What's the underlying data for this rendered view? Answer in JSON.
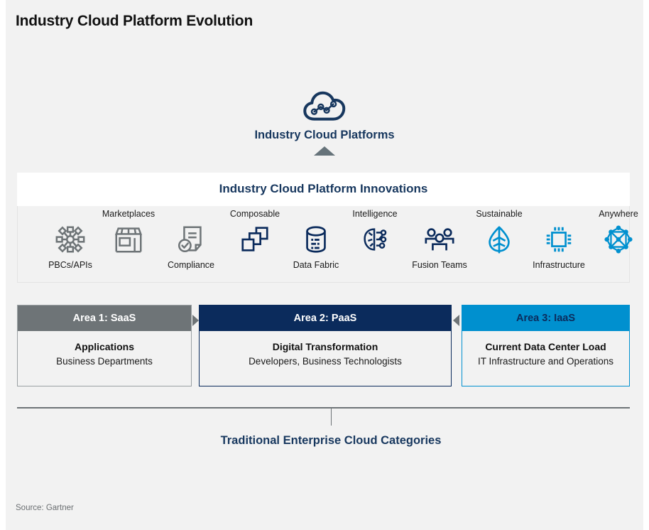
{
  "page": {
    "title": "Industry Cloud Platform Evolution",
    "source": "Source: Gartner",
    "background": "#f2f2f2"
  },
  "hero": {
    "icon": "cloud-network-icon",
    "label": "Industry Cloud Platforms",
    "caret": "up-triangle-icon",
    "color": "#17375e"
  },
  "innovations": {
    "title": "Industry Cloud Platform Innovations",
    "title_color": "#17375e",
    "items": [
      {
        "label": "PBCs/APIs",
        "icon": "hub-nodes-icon",
        "position": "below",
        "color": "#6e7477"
      },
      {
        "label": "Marketplaces",
        "icon": "storefront-icon",
        "position": "above",
        "color": "#6e7477"
      },
      {
        "label": "Compliance",
        "icon": "document-check-icon",
        "position": "below",
        "color": "#6e7477"
      },
      {
        "label": "Composable",
        "icon": "stacked-squares-icon",
        "position": "above",
        "color": "#0b2b5c"
      },
      {
        "label": "Data Fabric",
        "icon": "database-binary-icon",
        "position": "below",
        "color": "#0b2b5c"
      },
      {
        "label": "Intelligence",
        "icon": "brain-circuit-icon",
        "position": "above",
        "color": "#0b2b5c"
      },
      {
        "label": "Fusion Teams",
        "icon": "people-group-icon",
        "position": "below",
        "color": "#0b2b5c"
      },
      {
        "label": "Sustainable",
        "icon": "leaf-icon",
        "position": "above",
        "color": "#0090cf"
      },
      {
        "label": "Infrastructure",
        "icon": "chip-icon",
        "position": "below",
        "color": "#0090cf"
      },
      {
        "label": "Anywhere",
        "icon": "mesh-network-icon",
        "position": "above",
        "color": "#0090cf"
      }
    ]
  },
  "areas": [
    {
      "header": "Area 1: SaaS",
      "title": "Applications",
      "subtitle": "Business Departments",
      "header_bg": "#6e7477",
      "header_fg": "#ffffff"
    },
    {
      "header": "Area 2: PaaS",
      "title": "Digital Transformation",
      "subtitle": "Developers, Business Technologists",
      "header_bg": "#0b2b5c",
      "header_fg": "#ffffff"
    },
    {
      "header": "Area 3: IaaS",
      "title": "Current Data Center Load",
      "subtitle": "IT Infrastructure and Operations",
      "header_bg": "#0090cf",
      "header_fg": "#0b2b5c"
    }
  ],
  "connectors": {
    "right_arrow": "right-triangle-icon",
    "left_arrow": "left-triangle-icon",
    "color": "#6e7477"
  },
  "bracket": {
    "label": "Traditional Enterprise Cloud Categories",
    "color": "#17375e"
  }
}
